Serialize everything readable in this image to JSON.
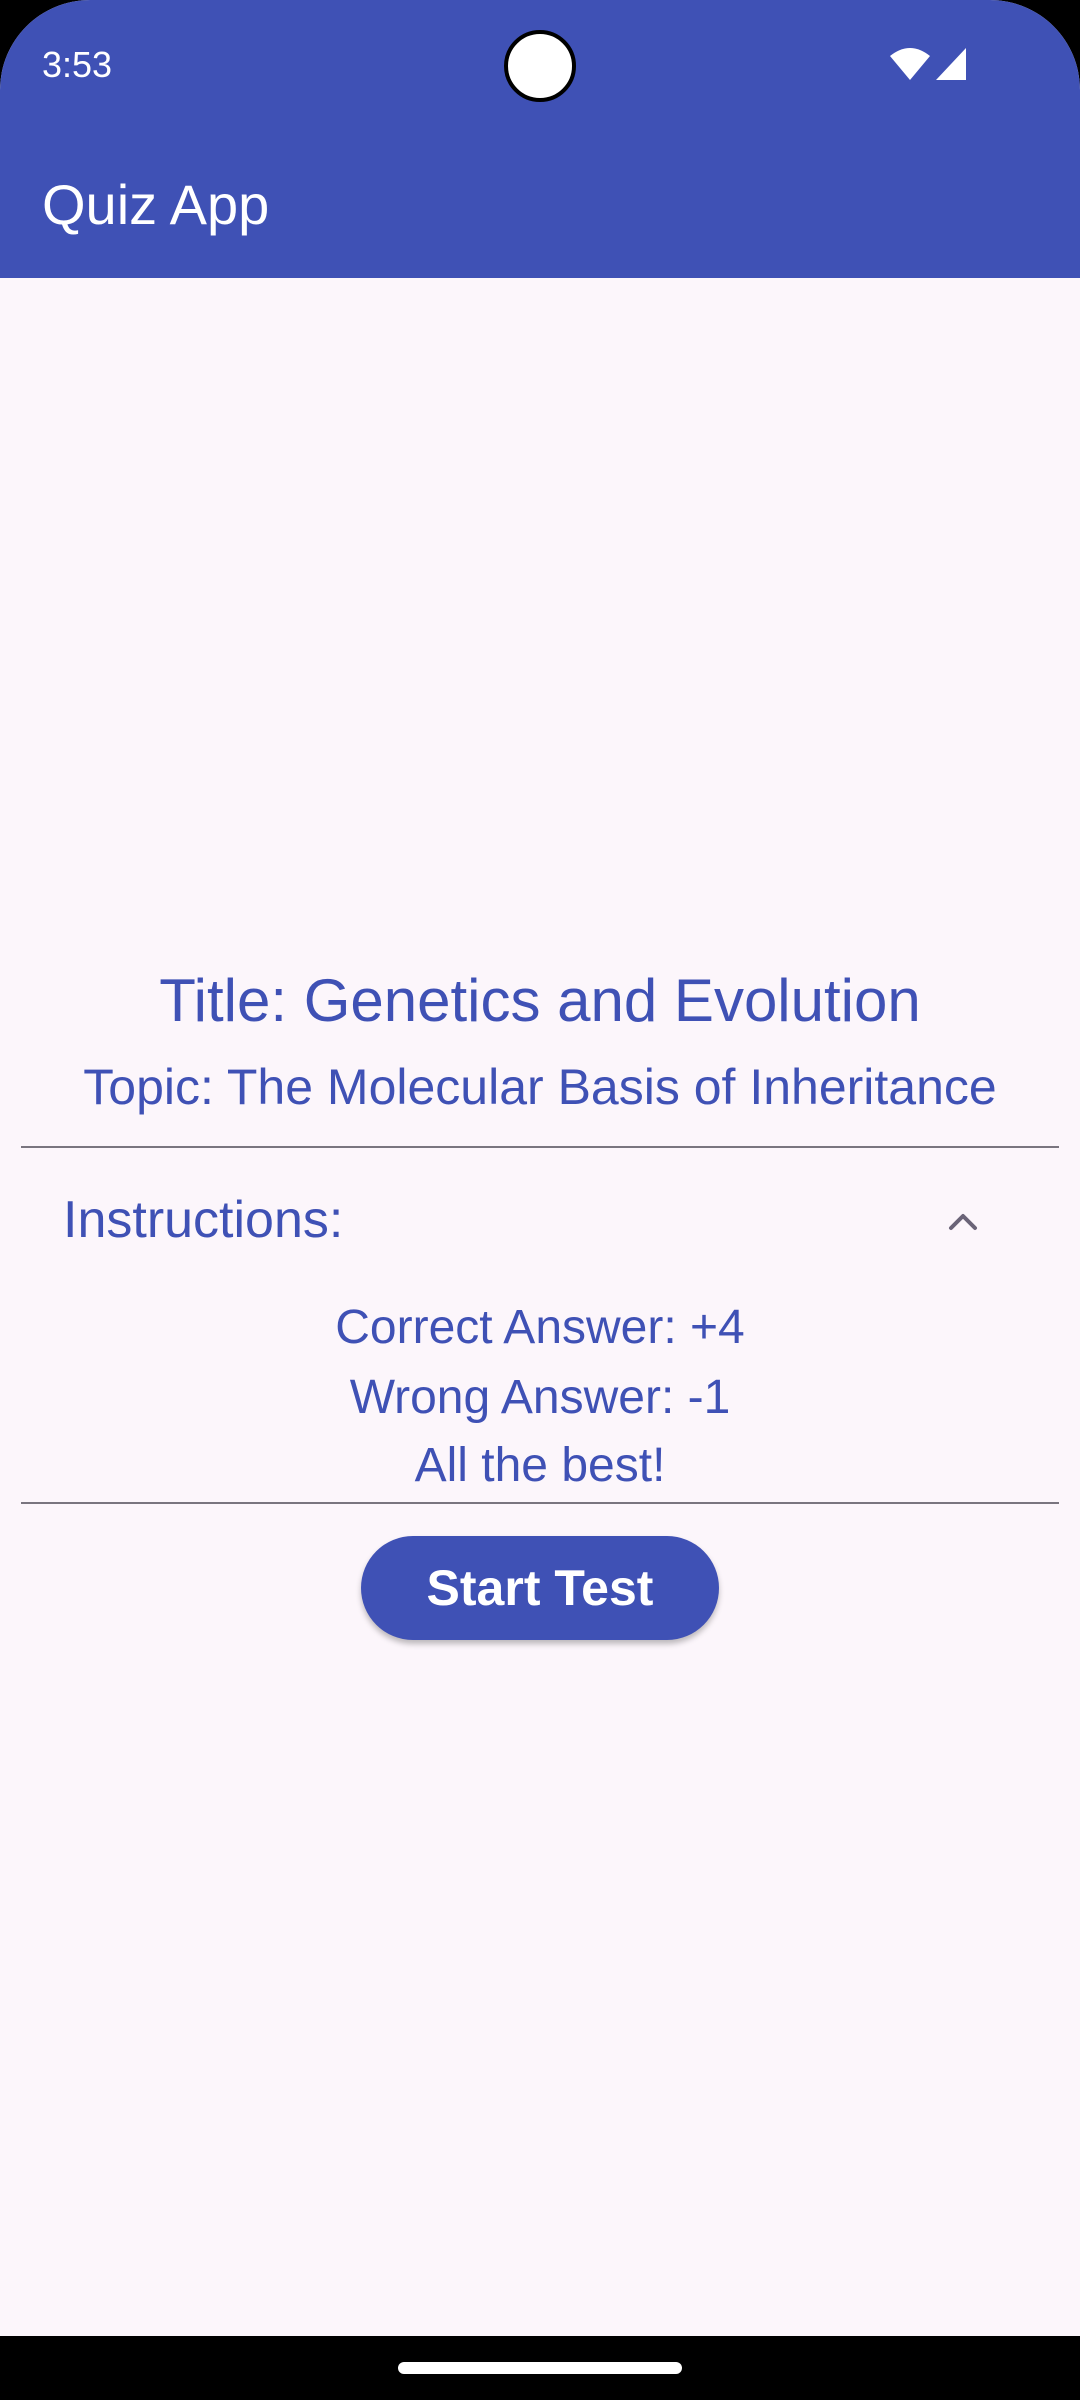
{
  "status_bar": {
    "time": "3:53",
    "icons": [
      "wifi-icon",
      "signal-icon"
    ]
  },
  "app_bar": {
    "title": "Quiz App"
  },
  "quiz": {
    "title": "Title: Genetics and Evolution",
    "topic": "Topic: The Molecular Basis of Inheritance"
  },
  "instructions": {
    "label": "Instructions:",
    "expanded": true,
    "toggle_icon": "chevron-up-icon",
    "lines": [
      "Correct Answer: +4",
      "Wrong Answer: -1",
      "All the best!"
    ]
  },
  "actions": {
    "start_label": "Start Test"
  },
  "colors": {
    "primary": "#3f51b5",
    "background": "#fcf6fb",
    "divider": "#7a757f",
    "on_primary": "#ffffff"
  }
}
